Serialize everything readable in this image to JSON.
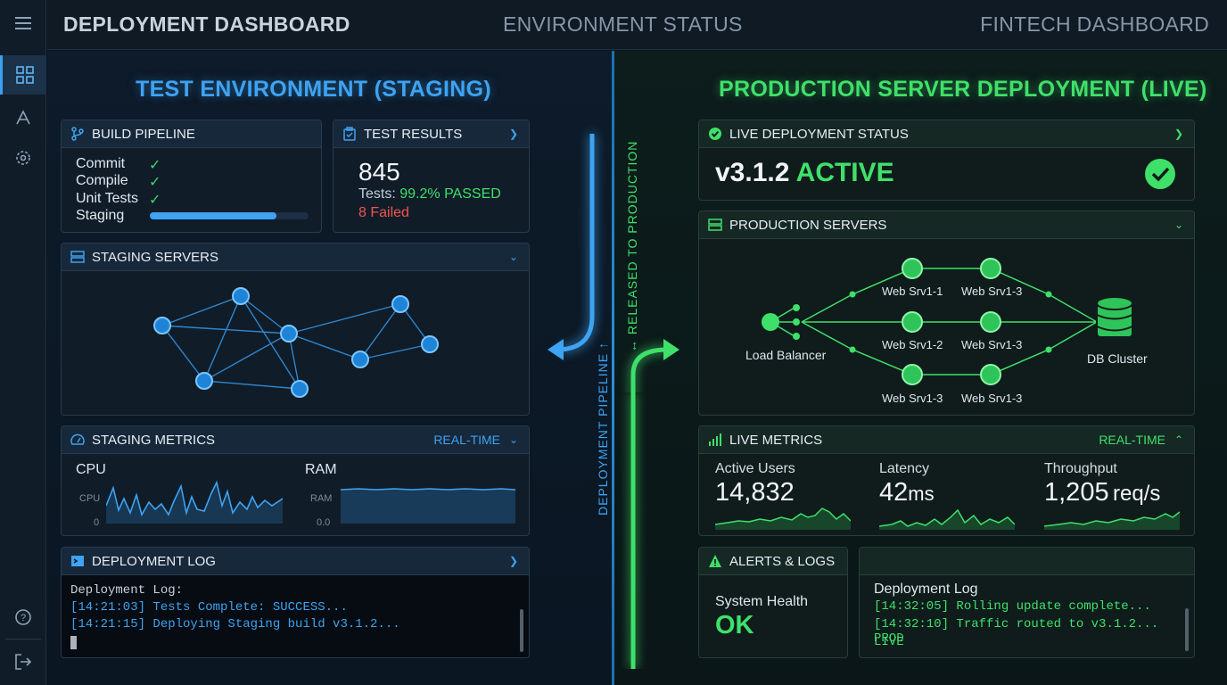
{
  "topbar": {
    "title": "DEPLOYMENT DASHBOARD",
    "center": "ENVIRONMENT STATUS",
    "right": "FINTECH DASHBOARD"
  },
  "sidebar": {
    "icons": [
      "menu-icon",
      "grid-icon",
      "rocket-icon",
      "gear-icon",
      "help-icon",
      "logout-icon"
    ]
  },
  "staging": {
    "title": "TEST ENVIRONMENT (STAGING)",
    "build_pipeline": {
      "header": "BUILD PIPELINE",
      "steps": [
        "Commit",
        "Compile",
        "Unit Tests",
        "Staging"
      ],
      "staging_progress": 0.8
    },
    "test_results": {
      "header": "TEST RESULTS",
      "count": "845",
      "tests_label": "Tests:",
      "passed": "99.2% PASSED",
      "failed": "8 Failed"
    },
    "servers": {
      "header": "STAGING SERVERS"
    },
    "metrics": {
      "header": "STAGING METRICS",
      "realtime": "REAL-TIME",
      "cpu_title": "CPU",
      "cpu_axis": "CPU",
      "cpu_zero": "0",
      "ram_title": "RAM",
      "ram_axis": "RAM",
      "ram_zero": "0.0"
    },
    "log": {
      "header": "DEPLOYMENT LOG",
      "lines": [
        "Deployment Log:",
        "[14:21:03] Tests Complete: SUCCESS...",
        "[14:21:15] Deploying Staging build v3.1.2..."
      ]
    }
  },
  "pipeline": {
    "left_label": "DEPLOYMENT PIPELINE ↑",
    "right_label": "↔ RELEASED TO PRODUCTION"
  },
  "production": {
    "title": "PRODUCTION SERVER DEPLOYMENT (LIVE)",
    "live_status": {
      "header": "LIVE DEPLOYMENT STATUS",
      "version": "v3.1.2",
      "state": "ACTIVE"
    },
    "servers": {
      "header": "PRODUCTION SERVERS",
      "load_balancer": "Load Balancer",
      "db": "DB Cluster",
      "nodes": [
        "Web Srv1-1",
        "Web Srv1-3",
        "Web Srv1-2",
        "Web Srv1-3",
        "Web Srv1-3",
        "Web Srv1-3"
      ]
    },
    "metrics": {
      "header": "LIVE METRICS",
      "realtime": "REAL-TIME",
      "active_users_label": "Active Users",
      "active_users": "14,832",
      "latency_label": "Latency",
      "latency_value": "42",
      "latency_unit": "ms",
      "throughput_label": "Throughput",
      "throughput_value": "1,205",
      "throughput_unit": "req/s"
    },
    "alerts": {
      "header": "ALERTS & LOGS",
      "health_label": "System Health",
      "health_value": "OK"
    },
    "log": {
      "title": "Deployment Log",
      "lines": [
        "[14:32:05] Rolling update complete...",
        "[14:32:10] Traffic routed to v3.1.2... PROD",
        "LIVE"
      ]
    }
  },
  "colors": {
    "staging_accent": "#3ea3f2",
    "production_accent": "#3fe06a",
    "failed": "#f0564f"
  }
}
